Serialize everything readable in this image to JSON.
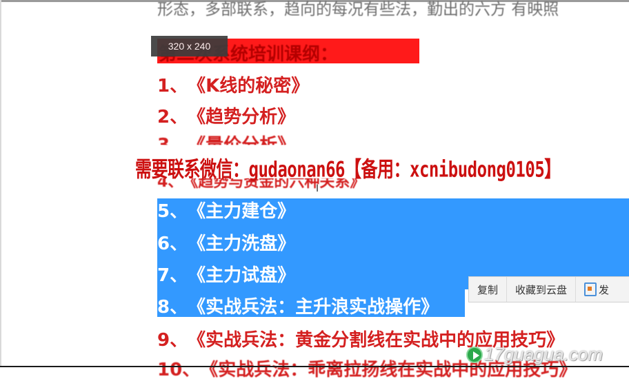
{
  "top_line": "形态，多部联系，趋向的每况有些法，勤出的六方 有映照",
  "heading": {
    "text": "第二次系统培训课纲：",
    "bar_color": "#ff1a1a"
  },
  "size_badge": "320 x 240",
  "outline_items": [
    {
      "num": "1、",
      "title": "《K线的秘密》"
    },
    {
      "num": "2、",
      "title": "《趋势分析》"
    },
    {
      "num": "3、",
      "title": "《量价分析》"
    },
    {
      "num": "4、",
      "title": "《趋势与资金的六种关系》"
    },
    {
      "num": "5、",
      "title": "《主力建仓》"
    },
    {
      "num": "6、",
      "title": "《主力洗盘》"
    },
    {
      "num": "7、",
      "title": "《主力试盘》"
    },
    {
      "num": "8、",
      "title": "《实战兵法：主升浪实战操作》"
    },
    {
      "num": "9、",
      "title": "《实战兵法：黄金分割线在实战中的应用技巧》"
    },
    {
      "num": "10、",
      "title": "《实战兵法：乖离拉扬线在实战中的应用技巧》"
    }
  ],
  "watermark": "需要联系微信：gudaonan66【备用：xcnibudong0105】",
  "context_menu": {
    "copy": "复制",
    "save_to_cloud": "收藏到云盘",
    "send": "发",
    "send_icon": "send-doc-icon"
  },
  "site_watermark": {
    "text": "17guagua.com",
    "icon": "play-icon"
  },
  "colors": {
    "item_red": "#d42020",
    "selection_blue": "#3399ff",
    "watermark_red": "#cc1010"
  }
}
